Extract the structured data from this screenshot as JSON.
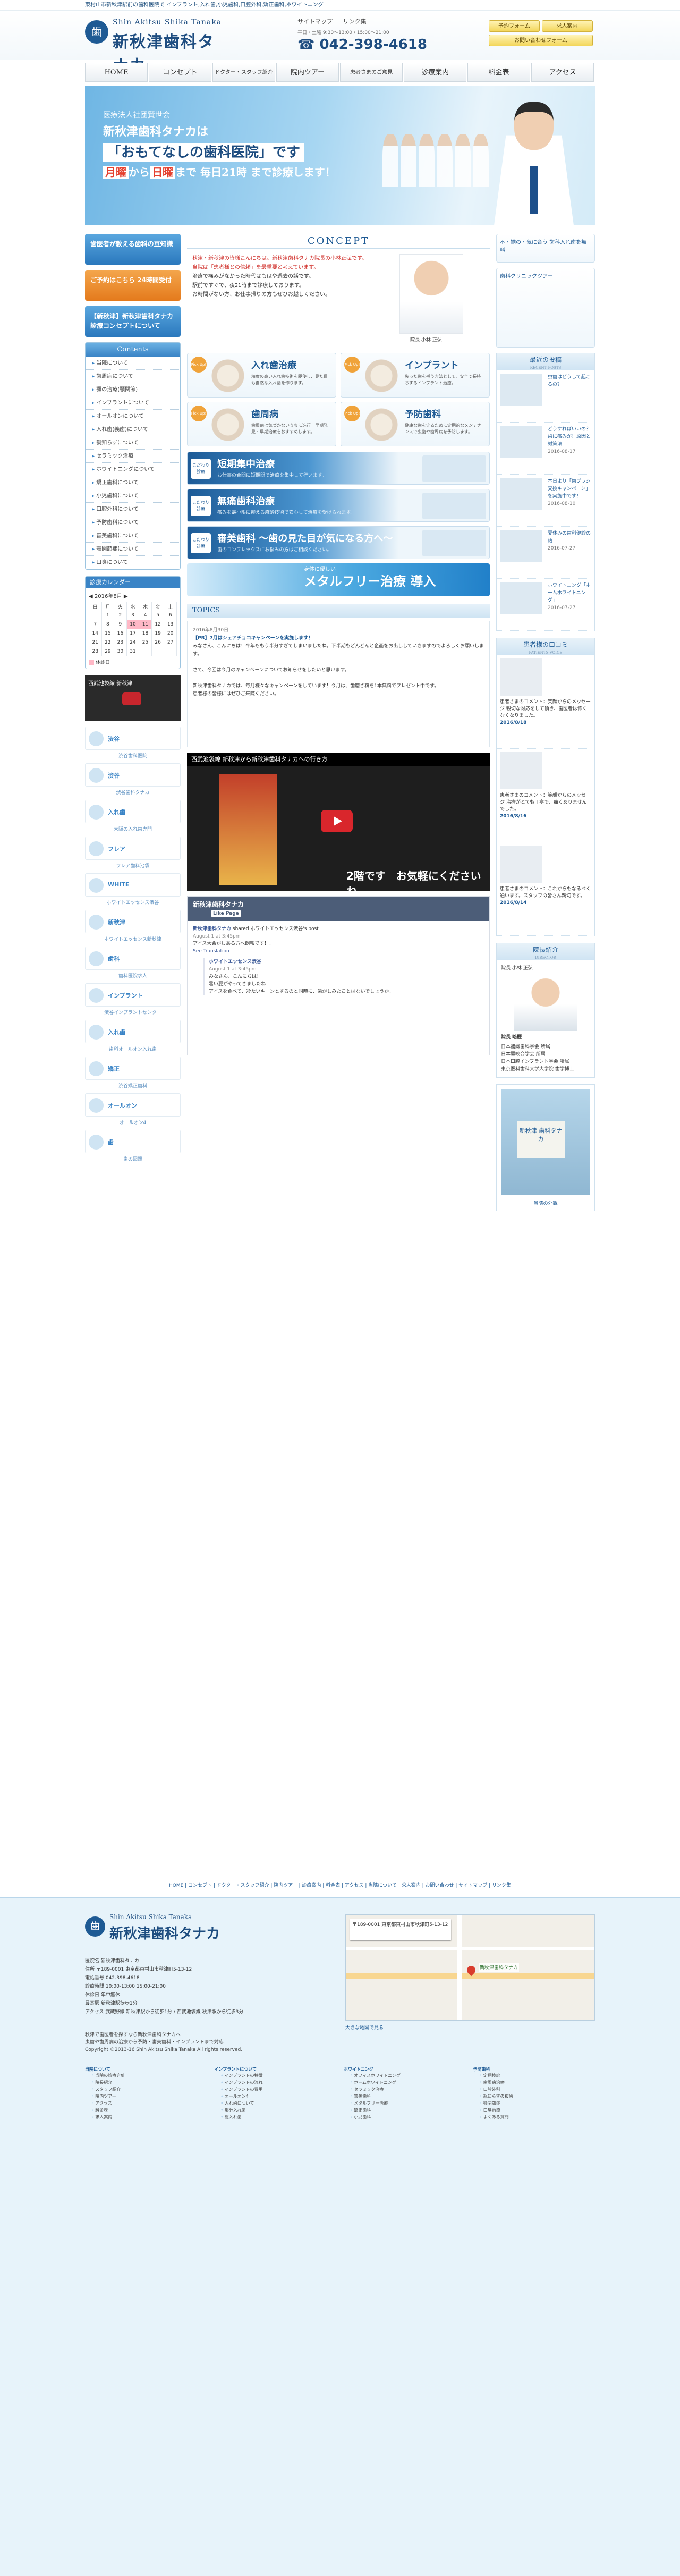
{
  "topline": "東村山市新秋津駅前の歯科医院で インプラント,入れ歯,小児歯科,口腔外科,矯正歯科,ホワイトニング",
  "header": {
    "logo_mark": "歯",
    "logo_en": "Shin Akitsu Shika Tanaka",
    "logo_jp": "新秋津歯科タナカ",
    "links": [
      "サイトマップ",
      "リンク集"
    ],
    "hours": "平日・土曜 9:30〜13:00 / 15:00〜21:00",
    "tel": "042-398-4618",
    "buttons": [
      "予約フォーム",
      "求人案内",
      "お問い合わせフォーム"
    ]
  },
  "nav": [
    "HOME",
    "コンセプト",
    "ドクター・スタッフ紹介",
    "院内ツアー",
    "患者さまのご意見",
    "診療案内",
    "料金表",
    "アクセス"
  ],
  "hero": {
    "line1": "医療法人社団賢世会",
    "line2": "新秋津歯科タナカは",
    "line3": "「おもてなしの歯科医院」です",
    "line4a": "月曜",
    "line4b": "から",
    "line4c": "日曜",
    "line4d": "まで 毎日21時 まで診療します！",
    "caption": "院長 小林 正弘"
  },
  "left": {
    "banners": [
      "歯医者が教える歯科の豆知識",
      "ご予約はこちら 24時間受付",
      "【新秋津】新秋津歯科タナカ 診療コンセプトについて"
    ],
    "menu_title": "Contents",
    "menu": [
      "当院について",
      "歯周病について",
      "顎の治療(顎関節)",
      "インプラントについて",
      "オールオンについて",
      "入れ歯(義歯)について",
      "親知らずについて",
      "セラミック治療",
      "ホワイトニングについて",
      "矯正歯科について",
      "小児歯科について",
      "口腔外科について",
      "予防歯科について",
      "審美歯科について",
      "顎関節症について",
      "口臭について"
    ],
    "calendar": {
      "title": "診療カレンダー",
      "month": "2016年8月",
      "days_header": [
        "日",
        "月",
        "火",
        "水",
        "木",
        "金",
        "土"
      ],
      "rows": [
        [
          "",
          "1",
          "2",
          "3",
          "4",
          "5",
          "6"
        ],
        [
          "7",
          "8",
          "9",
          "10",
          "11",
          "12",
          "13"
        ],
        [
          "14",
          "15",
          "16",
          "17",
          "18",
          "19",
          "20"
        ],
        [
          "21",
          "22",
          "23",
          "24",
          "25",
          "26",
          "27"
        ],
        [
          "28",
          "29",
          "30",
          "31",
          "",
          "",
          ""
        ]
      ],
      "legend": "休診日"
    },
    "video_caption": "西武池袋線 新秋津",
    "related": [
      {
        "t": "渋谷",
        "cap": "渋谷歯科医院"
      },
      {
        "t": "渋谷",
        "cap": "渋谷歯科タナカ"
      },
      {
        "t": "入れ歯",
        "cap": "大阪の入れ歯専門"
      },
      {
        "t": "フレア",
        "cap": "フレア歯科池袋"
      },
      {
        "t": "WHITE",
        "cap": "ホワイトエッセンス渋谷"
      },
      {
        "t": "新秋津",
        "cap": "ホワイトエッセンス新秋津"
      },
      {
        "t": "歯科",
        "cap": "歯科医院求人"
      },
      {
        "t": "インプラント",
        "cap": "渋谷インプラントセンター"
      },
      {
        "t": "入れ歯",
        "cap": "歯科オールオン入れ歯"
      },
      {
        "t": "矯正",
        "cap": "渋谷矯正歯科"
      },
      {
        "t": "オールオン",
        "cap": "オールオン4"
      },
      {
        "t": "歯",
        "cap": "歯の図鑑"
      }
    ]
  },
  "concept": {
    "title": "CONCEPT",
    "red1": "秋津・新秋津の皆様こんにちは。新秋津歯科タナカ院長の小林正弘です。",
    "red2": "当院は「患者様との信頼」を最重要と考えています。",
    "body1": "治療で痛みがなかった時代はもはや過去の話です。",
    "body2": "駅前ですぐで、夜21時まで診療しております。",
    "body3": "お時間がない方、お仕事帰りの方もぜひお越しください。",
    "portrait_caption": "院長 小林 正弘"
  },
  "services": [
    {
      "pick": "Pick Up!",
      "h": "入れ歯治療",
      "d": "精度の高い入れ歯技術を駆使し、見た目も自然な入れ歯を作ります。"
    },
    {
      "pick": "Pick Up!",
      "h": "インプラント",
      "d": "失った歯を補う方法として、安全で長持ちするインプラント治療。"
    },
    {
      "pick": "Pick Up!",
      "h": "歯周病",
      "d": "歯周病は気づかないうちに進行。早期発見・早期治療をおすすめします。"
    },
    {
      "pick": "Pick Up!",
      "h": "予防歯科",
      "d": "健康な歯を守るために定期的なメンテナンスで虫歯や歯周病を予防します。"
    }
  ],
  "features": [
    {
      "badge": "こだわり診療",
      "h": "短期集中治療",
      "d": "お仕事の合間に短期間で治療を集中して行います。"
    },
    {
      "badge": "こだわり診療",
      "h": "無痛歯科治療",
      "d": "痛みを最小限に抑える麻酔技術で安心して治療を受けられます。"
    },
    {
      "badge": "こだわり診療",
      "h": "審美歯科 ～歯の見た目が気になる方へ～",
      "d": "歯のコンプレックスにお悩みの方はご相談ください。"
    }
  ],
  "metal": {
    "small": "身体に優しい",
    "big": "メタルフリー治療 導入"
  },
  "topics": {
    "title": "TOPICS",
    "date1": "2016年8月30日",
    "head1": "【PR】7月はシェアチョコキャンペーンを実施します！",
    "body1": "みなさん、こんにちは！今年ももう半分すぎてしまいましたね。下半期もどんどんと企画をお出ししていきますのでよろしくお願いします。",
    "body2": "さて、今回は今月のキャンペーンについてお知らせをしたいと思います。",
    "body3": "新秋津歯科タナカでは、毎月様々なキャンペーンをしています！今月は、歯磨き粉を1本無料でプレゼント中です。",
    "body4": "患者様の皆様にはぜひご来院ください。"
  },
  "video": {
    "title": "西武池袋線 新秋津から新秋津歯科タナカへの行き方",
    "tel": "2階です　お気軽にくださいね"
  },
  "fb": {
    "page": "新秋津歯科タナカ",
    "like": "Like Page",
    "who": "新秋津歯科タナカ",
    "shared": "shared ホワイトエッセンス渋谷's post",
    "time": "August 1 at 3:45pm",
    "line": "アイス大会がしある方へ朗報です！！",
    "trans": "See Translation",
    "q_who": "ホワイトエッセンス渋谷",
    "q_time": "August 1 at 3:45pm",
    "q1": "みなさん、こんにちは！",
    "q2": "暑い夏がやってきましたね！",
    "q3": "アイスを食べて、冷たいキーンとするのと同時に、歯がしみたことはないでしょうか。"
  },
  "right": {
    "banner1": "不・揃の・気に合う 歯科入れ歯を無料",
    "banner2": "歯科クリニックツアー",
    "posts_title": "最近の投稿",
    "posts_sub": "RECENT POSTS",
    "posts": [
      {
        "t": "虫歯はどうして起こるの？",
        "dt": ""
      },
      {
        "t": "どうすればいいの？ 歯に痛みが！原因と対策法",
        "dt": "2016-08-17"
      },
      {
        "t": "本日より「歯ブラシ交換キャンペーン」を実施中です！",
        "dt": "2016-08-10"
      },
      {
        "t": "夏休みの歯科健診の話",
        "dt": "2016-07-27"
      },
      {
        "t": "ホワイトニング「ホームホワイトニング」",
        "dt": "2016-07-27"
      }
    ],
    "voice_title": "患者様の口コミ",
    "voice_sub": "PATIENTS VOICE",
    "voices": [
      {
        "t": "患者さまのコメント：笑顔からのメッセージ 親切な対応をして頂き、歯医者は怖くなくなりました。",
        "dt": "2016/8/18"
      },
      {
        "t": "患者さまのコメント：笑顔からのメッセージ 治療がとても丁寧で、痛くありませんでした。",
        "dt": "2016/8/16"
      },
      {
        "t": "患者さまのコメント：これからもなるべく通います。スタッフの皆さん親切です。",
        "dt": "2016/8/14"
      }
    ],
    "director_title": "院長紹介",
    "director_sub": "DIRECTOR",
    "director_caption": "院長 小林 正弘",
    "director_name": "院長 略歴",
    "director_lines": [
      "日本補綴歯科学会 所属",
      "日本顎咬合学会 所属",
      "日本口腔インプラント学会 所属",
      "東京医科歯科大学大学院 歯学博士"
    ],
    "clinic_sign": "新秋津 歯科タナカ",
    "clinic_caption": "当院の外観"
  },
  "bottom_links": "HOME | コンセプト | ドクター・スタッフ紹介 | 院内ツアー | 診療案内 | 料金表 | アクセス | 当院について | 求人案内 | お問い合わせ | サイトマップ | リンク集",
  "footer": {
    "logo_mark": "歯",
    "logo_en": "Shin Akitsu Shika Tanaka",
    "logo_jp": "新秋津歯科タナカ",
    "info": [
      "医院名 新秋津歯科タナカ",
      "住所 〒189-0001 東京都東村山市秋津町5-13-12",
      "電話番号 042-398-4618",
      "診療時間 10:00-13:00 15:00-21:00",
      "休診日 年中無休",
      "最寄駅 新秋津駅徒歩1分",
      "アクセス 武蔵野線 新秋津駅から徒歩1分 / 西武池袋線 秋津駅から徒歩3分"
    ],
    "map_card": "〒189-0001 東京都東村山市秋津町5-13-12",
    "map_label": "新秋津歯科タナカ",
    "map_link": "大きな地図で見る",
    "copy1": "秋津で歯医者を探すなら新秋津歯科タナカへ",
    "copy2": "虫歯や歯周病の治療から予防・審美歯科・インプラントまで対応",
    "copy3": "Copyright ©2013-16 Shin Akitsu Shika Tanaka All rights reserved."
  },
  "sitemap": [
    {
      "h": "当院について",
      "items": [
        "当院の診療方針",
        "院長紹介",
        "スタッフ紹介",
        "院内ツアー",
        "アクセス",
        "料金表",
        "求人案内"
      ]
    },
    {
      "h": "インプラントについて",
      "items": [
        "インプラントの特徴",
        "インプラントの流れ",
        "インプラントの費用",
        "オールオン4",
        "入れ歯について",
        "部分入れ歯",
        "総入れ歯"
      ]
    },
    {
      "h": "ホワイトニング",
      "items": [
        "オフィスホワイトニング",
        "ホームホワイトニング",
        "セラミック治療",
        "審美歯科",
        "メタルフリー治療",
        "矯正歯科",
        "小児歯科"
      ]
    },
    {
      "h": "予防歯科",
      "items": [
        "定期検診",
        "歯周病治療",
        "口腔外科",
        "親知らずの抜歯",
        "顎関節症",
        "口臭治療",
        "よくある質問"
      ]
    }
  ]
}
